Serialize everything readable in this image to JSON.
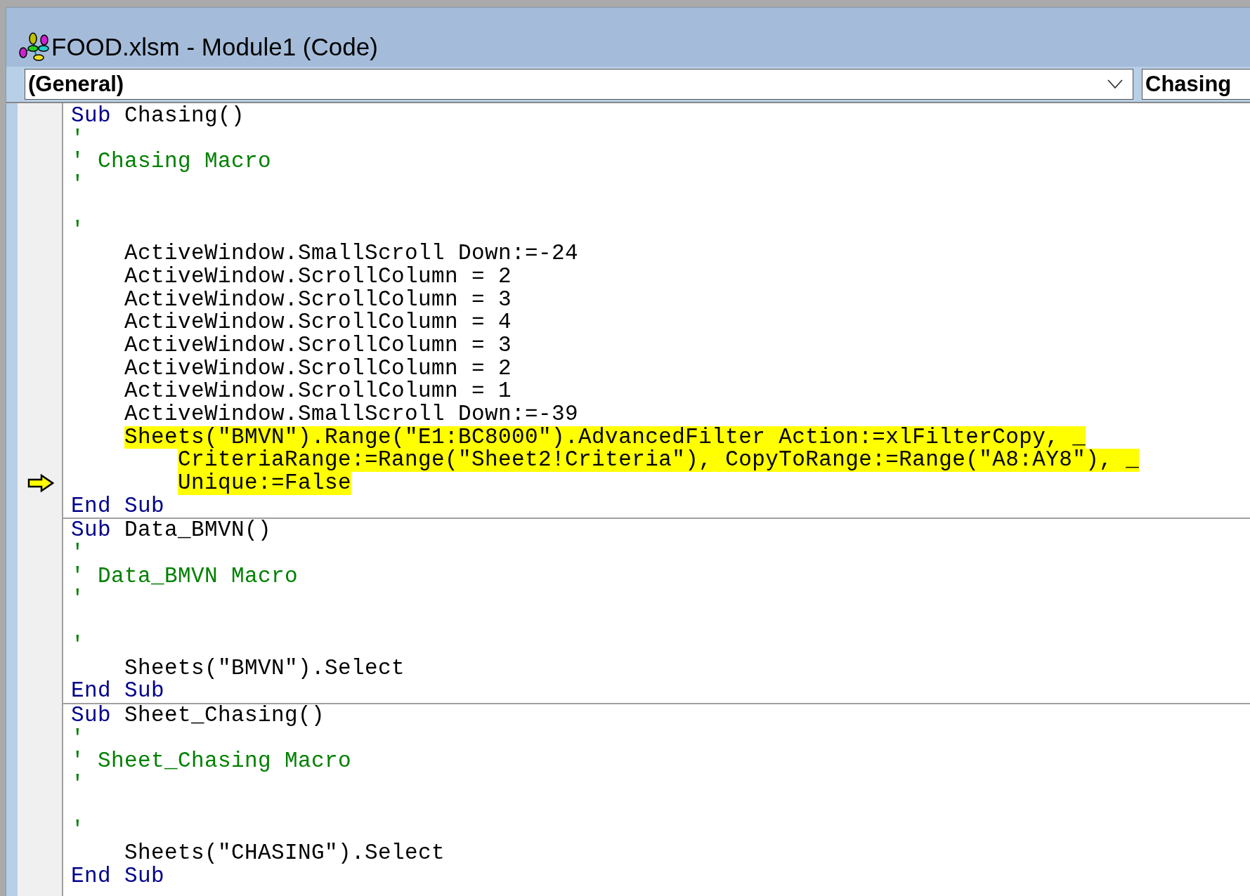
{
  "window": {
    "title": "FOOD.xlsm - Module1 (Code)"
  },
  "object_box": {
    "value": "(General)"
  },
  "procedure_box": {
    "value": "Chasing"
  },
  "procedures": [
    {
      "lines": [
        {
          "kind": "code",
          "highlighted": false,
          "current": false,
          "segments": [
            {
              "kind": "keyword",
              "text": "Sub"
            },
            {
              "kind": "plain",
              "text": " Chasing()"
            }
          ]
        },
        {
          "kind": "code",
          "highlighted": false,
          "current": false,
          "segments": [
            {
              "kind": "comment",
              "text": "'"
            }
          ]
        },
        {
          "kind": "code",
          "highlighted": false,
          "current": false,
          "segments": [
            {
              "kind": "comment",
              "text": "' Chasing Macro"
            }
          ]
        },
        {
          "kind": "code",
          "highlighted": false,
          "current": false,
          "segments": [
            {
              "kind": "comment",
              "text": "'"
            }
          ]
        },
        {
          "kind": "blank"
        },
        {
          "kind": "code",
          "highlighted": false,
          "current": false,
          "segments": [
            {
              "kind": "comment",
              "text": "'"
            }
          ]
        },
        {
          "kind": "code",
          "highlighted": false,
          "current": false,
          "segments": [
            {
              "kind": "plain",
              "text": "    ActiveWindow.SmallScroll Down:=-24"
            }
          ]
        },
        {
          "kind": "code",
          "highlighted": false,
          "current": false,
          "segments": [
            {
              "kind": "plain",
              "text": "    ActiveWindow.ScrollColumn = 2"
            }
          ]
        },
        {
          "kind": "code",
          "highlighted": false,
          "current": false,
          "segments": [
            {
              "kind": "plain",
              "text": "    ActiveWindow.ScrollColumn = 3"
            }
          ]
        },
        {
          "kind": "code",
          "highlighted": false,
          "current": false,
          "segments": [
            {
              "kind": "plain",
              "text": "    ActiveWindow.ScrollColumn = 4"
            }
          ]
        },
        {
          "kind": "code",
          "highlighted": false,
          "current": false,
          "segments": [
            {
              "kind": "plain",
              "text": "    ActiveWindow.ScrollColumn = 3"
            }
          ]
        },
        {
          "kind": "code",
          "highlighted": false,
          "current": false,
          "segments": [
            {
              "kind": "plain",
              "text": "    ActiveWindow.ScrollColumn = 2"
            }
          ]
        },
        {
          "kind": "code",
          "highlighted": false,
          "current": false,
          "segments": [
            {
              "kind": "plain",
              "text": "    ActiveWindow.ScrollColumn = 1"
            }
          ]
        },
        {
          "kind": "code",
          "highlighted": false,
          "current": false,
          "segments": [
            {
              "kind": "plain",
              "text": "    ActiveWindow.SmallScroll Down:=-39"
            }
          ]
        },
        {
          "kind": "code",
          "highlighted": true,
          "current": false,
          "segments": [
            {
              "kind": "plain",
              "text": "    Sheets(\"BMVN\").Range(\"E1:BC8000\").AdvancedFilter Action:=xlFilterCopy, _"
            }
          ]
        },
        {
          "kind": "code",
          "highlighted": true,
          "current": false,
          "segments": [
            {
              "kind": "plain",
              "text": "        CriteriaRange:=Range(\"Sheet2!Criteria\"), CopyToRange:=Range(\"A8:AY8\"), _"
            }
          ]
        },
        {
          "kind": "code",
          "highlighted": true,
          "current": true,
          "segments": [
            {
              "kind": "plain",
              "text": "        Unique:=False"
            }
          ]
        },
        {
          "kind": "code",
          "highlighted": false,
          "current": false,
          "segments": [
            {
              "kind": "keyword",
              "text": "End Sub"
            }
          ]
        }
      ]
    },
    {
      "lines": [
        {
          "kind": "code",
          "highlighted": false,
          "current": false,
          "segments": [
            {
              "kind": "keyword",
              "text": "Sub"
            },
            {
              "kind": "plain",
              "text": " Data_BMVN()"
            }
          ]
        },
        {
          "kind": "code",
          "highlighted": false,
          "current": false,
          "segments": [
            {
              "kind": "comment",
              "text": "'"
            }
          ]
        },
        {
          "kind": "code",
          "highlighted": false,
          "current": false,
          "segments": [
            {
              "kind": "comment",
              "text": "' Data_BMVN Macro"
            }
          ]
        },
        {
          "kind": "code",
          "highlighted": false,
          "current": false,
          "segments": [
            {
              "kind": "comment",
              "text": "'"
            }
          ]
        },
        {
          "kind": "blank"
        },
        {
          "kind": "code",
          "highlighted": false,
          "current": false,
          "segments": [
            {
              "kind": "comment",
              "text": "'"
            }
          ]
        },
        {
          "kind": "code",
          "highlighted": false,
          "current": false,
          "segments": [
            {
              "kind": "plain",
              "text": "    Sheets(\"BMVN\").Select"
            }
          ]
        },
        {
          "kind": "code",
          "highlighted": false,
          "current": false,
          "segments": [
            {
              "kind": "keyword",
              "text": "End Sub"
            }
          ]
        }
      ]
    },
    {
      "lines": [
        {
          "kind": "code",
          "highlighted": false,
          "current": false,
          "segments": [
            {
              "kind": "keyword",
              "text": "Sub"
            },
            {
              "kind": "plain",
              "text": " Sheet_Chasing()"
            }
          ]
        },
        {
          "kind": "code",
          "highlighted": false,
          "current": false,
          "segments": [
            {
              "kind": "comment",
              "text": "'"
            }
          ]
        },
        {
          "kind": "code",
          "highlighted": false,
          "current": false,
          "segments": [
            {
              "kind": "comment",
              "text": "' Sheet_Chasing Macro"
            }
          ]
        },
        {
          "kind": "code",
          "highlighted": false,
          "current": false,
          "segments": [
            {
              "kind": "comment",
              "text": "'"
            }
          ]
        },
        {
          "kind": "blank"
        },
        {
          "kind": "code",
          "highlighted": false,
          "current": false,
          "segments": [
            {
              "kind": "comment",
              "text": "'"
            }
          ]
        },
        {
          "kind": "code",
          "highlighted": false,
          "current": false,
          "segments": [
            {
              "kind": "plain",
              "text": "    Sheets(\"CHASING\").Select"
            }
          ]
        },
        {
          "kind": "code",
          "highlighted": false,
          "current": false,
          "segments": [
            {
              "kind": "keyword",
              "text": "End Sub"
            }
          ]
        }
      ]
    }
  ]
}
